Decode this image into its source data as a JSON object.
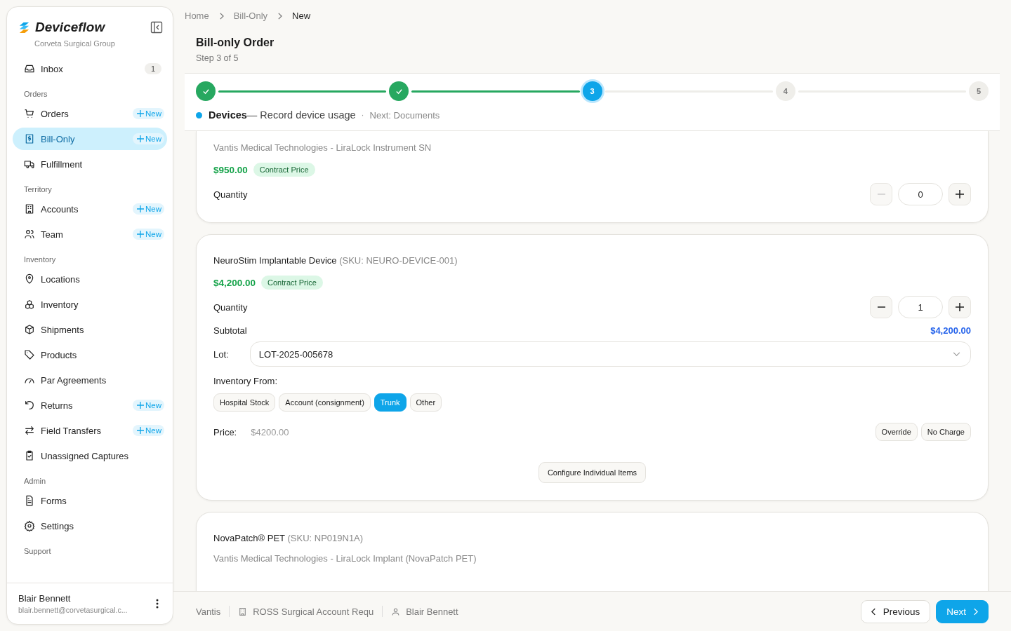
{
  "sidebar": {
    "brand": "Deviceflow",
    "org": "Corveta Surgical Group",
    "sections": [
      {
        "items": [
          {
            "label": "Inbox",
            "count": "1",
            "selected": false
          }
        ]
      },
      {
        "title": "Orders",
        "items": [
          {
            "label": "Orders",
            "new": "New",
            "selected": false
          },
          {
            "label": "Bill-Only",
            "new": "New",
            "selected": true
          },
          {
            "label": "Fulfillment",
            "selected": false
          }
        ]
      },
      {
        "title": "Territory",
        "items": [
          {
            "label": "Accounts",
            "new": "New",
            "selected": false
          },
          {
            "label": "Team",
            "new": "New",
            "selected": false
          }
        ]
      },
      {
        "title": "Inventory",
        "items": [
          {
            "label": "Locations",
            "selected": false
          },
          {
            "label": "Inventory",
            "selected": false
          },
          {
            "label": "Shipments",
            "selected": false
          },
          {
            "label": "Products",
            "selected": false
          },
          {
            "label": "Par Agreements",
            "selected": false
          },
          {
            "label": "Returns",
            "new": "New",
            "selected": false
          },
          {
            "label": "Field Transfers",
            "new": "New",
            "selected": false
          },
          {
            "label": "Unassigned Captures",
            "selected": false
          }
        ]
      },
      {
        "title": "Admin",
        "items": [
          {
            "label": "Forms",
            "selected": false
          },
          {
            "label": "Settings",
            "selected": false
          }
        ]
      },
      {
        "title": "Support"
      }
    ],
    "user": {
      "name": "Blair Bennett",
      "email": "blair.bennett@corvetasurgical.c..."
    }
  },
  "breadcrumbs": [
    "Home",
    "Bill-Only",
    "New"
  ],
  "page": {
    "title": "Bill-only Order",
    "subtitle": "Step 3 of 5"
  },
  "stepper": {
    "steps": [
      {
        "completed": true
      },
      {
        "completed": true
      },
      {
        "label": "3",
        "completed": false,
        "current": true
      },
      {
        "label": "4",
        "completed": false,
        "current": false
      },
      {
        "label": "5",
        "completed": false,
        "current": false
      }
    ],
    "current_name": "Devices",
    "current_desc": "— Record device usage",
    "separator": "·",
    "next": "Next: Documents"
  },
  "cards": [
    {
      "kind": "compact",
      "vendor": "Vantis Medical Technologies - LiraLock Instrument SN",
      "price": "$950.00",
      "price_tag": "Contract Price",
      "quantity_label": "Quantity",
      "quantity": "0",
      "minus_disabled": true
    },
    {
      "kind": "full",
      "name": "NeuroStim Implantable Device",
      "sku": "(SKU: NEURO-DEVICE-001)",
      "price": "$4,200.00",
      "price_tag": "Contract Price",
      "quantity_label": "Quantity",
      "quantity": "1",
      "minus_disabled": false,
      "subtotal_label": "Subtotal",
      "subtotal": "$4,200.00",
      "lot_label": "Lot:",
      "lot": "LOT-2025-005678",
      "source_label": "Inventory From:",
      "sources": [
        {
          "label": "Hospital Stock",
          "selected": false
        },
        {
          "label": "Account (consignment)",
          "selected": false
        },
        {
          "label": "Trunk",
          "selected": true
        },
        {
          "label": "Other",
          "selected": false
        }
      ],
      "price_label": "Price:",
      "price_value": "$4200.00",
      "price_actions": [
        "Override",
        "No Charge"
      ],
      "configure": "Configure Individual Items"
    },
    {
      "kind": "header",
      "name": "NovaPatch® PET",
      "sku": "(SKU: NP019N1A)",
      "vendor": "Vantis Medical Technologies - LiraLock Implant (NovaPatch PET)"
    }
  ],
  "footer": {
    "account": "Vantis",
    "request": "ROSS Surgical Account Requ",
    "user": "Blair Bennett",
    "previous": "Previous",
    "next": "Next"
  }
}
